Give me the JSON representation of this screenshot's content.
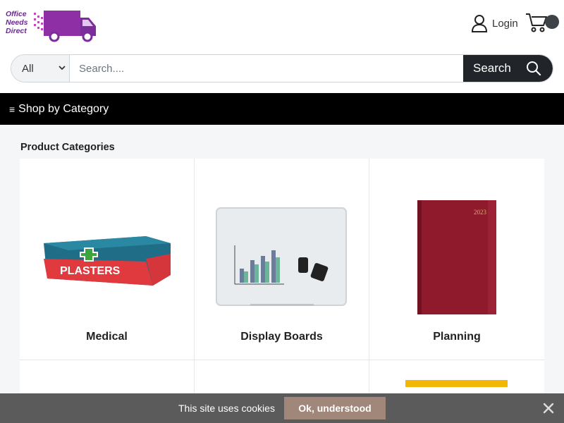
{
  "header": {
    "logo_text_lines": [
      "Office",
      "Needs",
      "Direct"
    ],
    "logo_icon": "delivery-van-icon",
    "login_label": "Login",
    "login_icon": "user-icon",
    "cart_icon": "shopping-cart-icon"
  },
  "search": {
    "category_value": "All",
    "placeholder": "Search....",
    "button_label": "Search",
    "button_icon": "search-icon"
  },
  "nav": {
    "menu_icon": "≡",
    "label": "Shop by Category"
  },
  "main": {
    "section_title": "Product Categories",
    "categories": [
      {
        "label": "Medical",
        "image": "plasters-box-image"
      },
      {
        "label": "Display Boards",
        "image": "whiteboard-image"
      },
      {
        "label": "Planning",
        "image": "diary-image"
      },
      {
        "label": "",
        "image": ""
      },
      {
        "label": "",
        "image": ""
      },
      {
        "label": "",
        "image": "yellow-product-image"
      }
    ]
  },
  "cookie": {
    "text": "This site uses cookies",
    "button_label": "Ok, understood",
    "close_icon": "close-icon"
  },
  "colors": {
    "brand_purple": "#7b2d9c",
    "nav_bg": "#000000",
    "search_button": "#212529",
    "cookie_bar": "#5b5b5b",
    "cookie_button": "#a0877a"
  }
}
